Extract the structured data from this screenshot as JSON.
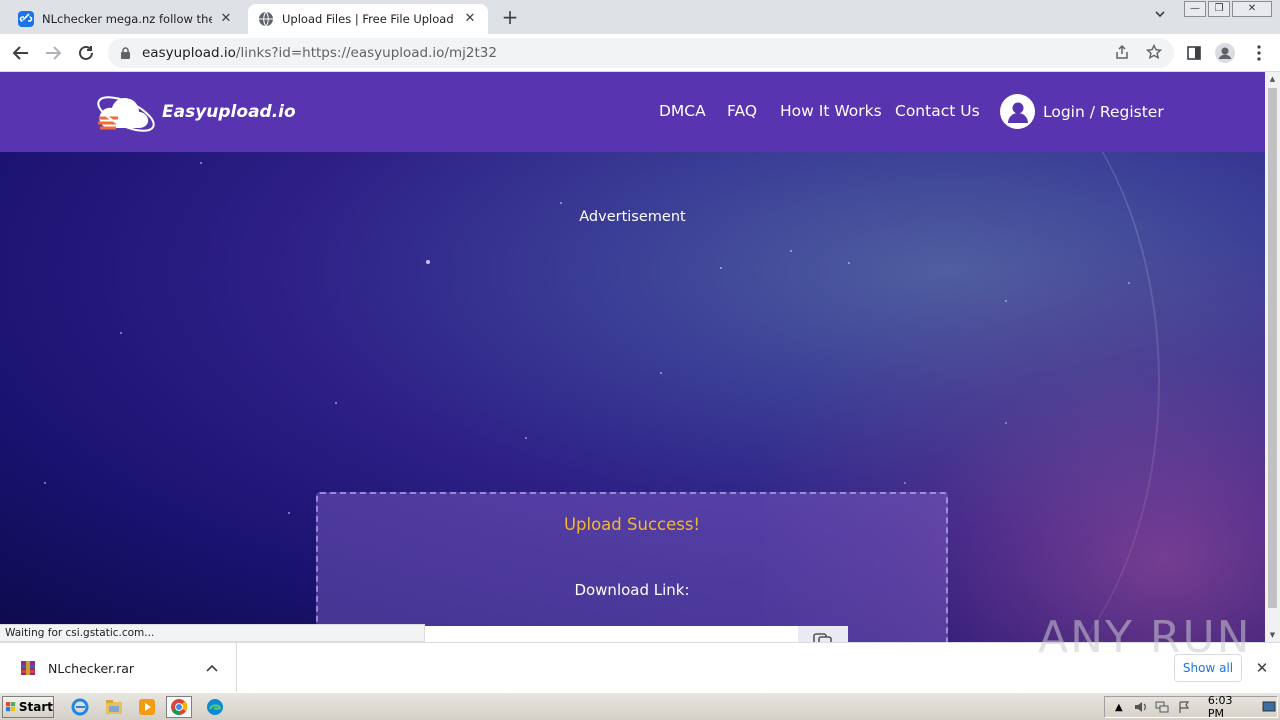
{
  "browser": {
    "tabs": [
      {
        "title": "NLchecker mega.nz follow the link — ",
        "favicon": "link-icon",
        "active": false
      },
      {
        "title": "Upload Files | Free File Upload and T",
        "favicon": "globe-icon",
        "active": true
      }
    ],
    "url_host": "easyupload.io",
    "url_path": "/links?id=https://easyupload.io/mj2t32",
    "status_text": "Waiting for csi.gstatic.com..."
  },
  "site": {
    "brand": "Easyupload.io",
    "nav": [
      "DMCA",
      "FAQ",
      "How It Works",
      "Contact Us"
    ],
    "login_label": "Login / Register",
    "ad_label": "Advertisement",
    "upload_success": "Upload Success!",
    "download_label": "Download Link:",
    "link_value": ""
  },
  "downloads": {
    "file_name": "NLchecker.rar",
    "show_all": "Show all"
  },
  "watermark": "ANY RUN",
  "taskbar": {
    "start_label": "Start",
    "clock": "6:03 PM"
  },
  "colors": {
    "header_bg": "#5834b0",
    "success_text": "#f5b72e",
    "link_blue": "#1a73e8"
  }
}
